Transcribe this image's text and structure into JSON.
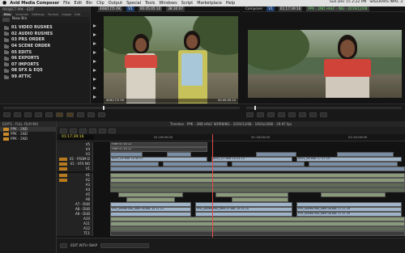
{
  "menubar": {
    "apple": "",
    "app": "Avid Media Composer",
    "items": [
      "File",
      "Edit",
      "Bin",
      "Clip",
      "Output",
      "Special",
      "Tools",
      "Windows",
      "Script",
      "Marketplace",
      "Help"
    ],
    "status_date": "Sun Dec 15 2:22 PM",
    "user": "SREEKARS IMAC 3"
  },
  "project": {
    "title": "PROJECT PPK - EDIT",
    "tabs": [
      "Bins",
      "Volumes",
      "Settings",
      "Format",
      "Usage",
      "Info"
    ],
    "new_bin": "New Bin",
    "bins": [
      "01 VIDEO RUSHES",
      "02 AUDIO RUSHES",
      "03 PRS ORDER",
      "04 SCENE ORDER",
      "05 EDITS",
      "06 EXPORTS",
      "07 IMPORTS",
      "08 SFX & EQS",
      "99 ATTIC"
    ]
  },
  "source_monitor": {
    "label": "408/17/5 OK",
    "track": "V1",
    "tc1": "00:45:05:10",
    "tc2": "38:30:07",
    "overlay_left": "408/17/5 OK",
    "overlay_right": "00:45:05:10"
  },
  "record_monitor": {
    "window": "Composer",
    "track": "V1",
    "tc": "01:17:39:16",
    "sequence": "PPK - 2ND HALF - ING - 2019/12/08"
  },
  "sequences": {
    "title": "EDITS - FULL FILM WO",
    "items": [
      "PPK - 2ND",
      "PPK - 2ND",
      "PPK - 2ND"
    ]
  },
  "timeline": {
    "header": "Timeline - PPK - 2ND HALF WORKING - 2019/12/08 - 1920x1080 - 29.97 fps",
    "timecode": "01:17:39:16",
    "ruler": [
      "01:16:00:00",
      "01:18:00:00",
      "01:20:00:00"
    ],
    "tracks": [
      "V5",
      "V4",
      "V3",
      "V2 - FROM D",
      "V1 - VFX NO",
      "V1",
      "A1",
      "A2",
      "A3",
      "A4",
      "A5",
      "A6",
      "A7 - DUB",
      "A8 - DUB",
      "A9 - DUB",
      "A10",
      "A11",
      "A12",
      "TC1"
    ],
    "clips": {
      "v5": "Filler 47 43 12",
      "v4": "Filler 47 43 12",
      "v2": "REEL_05 thor 14 50 07",
      "v1a": "REEL_07 thor 14 53 13",
      "v1b": "REEL_08 thor 17 57 29",
      "a7": "PPK_Stereo MIX_Reel 06.aac 10 21 13",
      "a8": "PPK_Stereo MIX_Reel 07.aac 14 55 10",
      "a9": "PPK_Stereo MIX_Reel 08.aac 17 57 29",
      "a10": "PPK_Stereo MIX_Reel 08.aac 17 57 29"
    }
  },
  "bottom": {
    "label": "EDIT WITH SNAP"
  }
}
